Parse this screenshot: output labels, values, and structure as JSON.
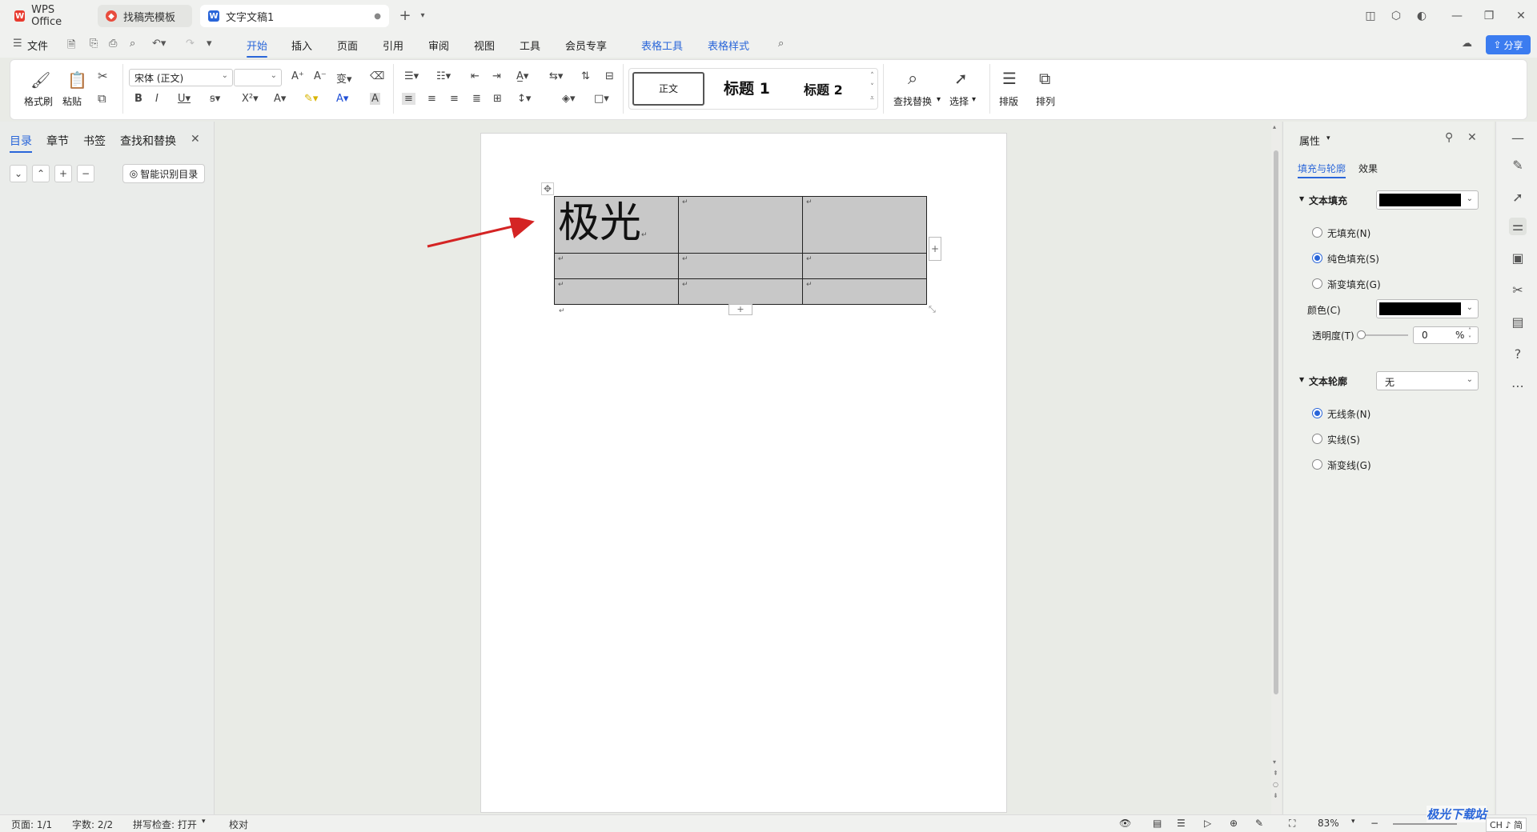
{
  "titlebar": {
    "tabs": [
      {
        "label": "WPS Office"
      },
      {
        "label": "找稿壳模板"
      },
      {
        "label": "文字文稿1"
      }
    ]
  },
  "menu": {
    "file": "文件",
    "items": [
      "开始",
      "插入",
      "页面",
      "引用",
      "审阅",
      "视图",
      "工具",
      "会员专享"
    ],
    "context": [
      "表格工具",
      "表格样式"
    ],
    "share": "分享"
  },
  "ribbon": {
    "format_painter": "格式刷",
    "paste": "粘贴",
    "font_name": "宋体 (正文)",
    "font_size": "",
    "styles": [
      "正文",
      "标题 1",
      "标题 2"
    ],
    "find_replace": "查找替换",
    "select": "选择",
    "layout": "排版",
    "arrange": "排列"
  },
  "leftpanel": {
    "tabs": [
      "目录",
      "章节",
      "书签",
      "查找和替换"
    ],
    "smart_toc": "智能识别目录"
  },
  "document": {
    "cell_text": "极光"
  },
  "props": {
    "title": "属性",
    "tabs": [
      "填充与轮廓",
      "效果"
    ],
    "text_fill": "文本填充",
    "fill_options": [
      "无填充(N)",
      "纯色填充(S)",
      "渐变填充(G)"
    ],
    "fill_selected": 1,
    "color_label": "颜色(C)",
    "transparency_label": "透明度(T)",
    "transparency_value": "0",
    "transparency_unit": "%",
    "text_outline": "文本轮廓",
    "outline_value": "无",
    "outline_options": [
      "无线条(N)",
      "实线(S)",
      "渐变线(G)"
    ],
    "outline_selected": 0,
    "fill_color": "#000000"
  },
  "status": {
    "page": "页面: 1/1",
    "words": "字数: 2/2",
    "spell": "拼写检查: 打开",
    "proof": "校对",
    "zoom": "83%",
    "watermark": "极光下载站",
    "ime": "CH ♪ 简"
  }
}
